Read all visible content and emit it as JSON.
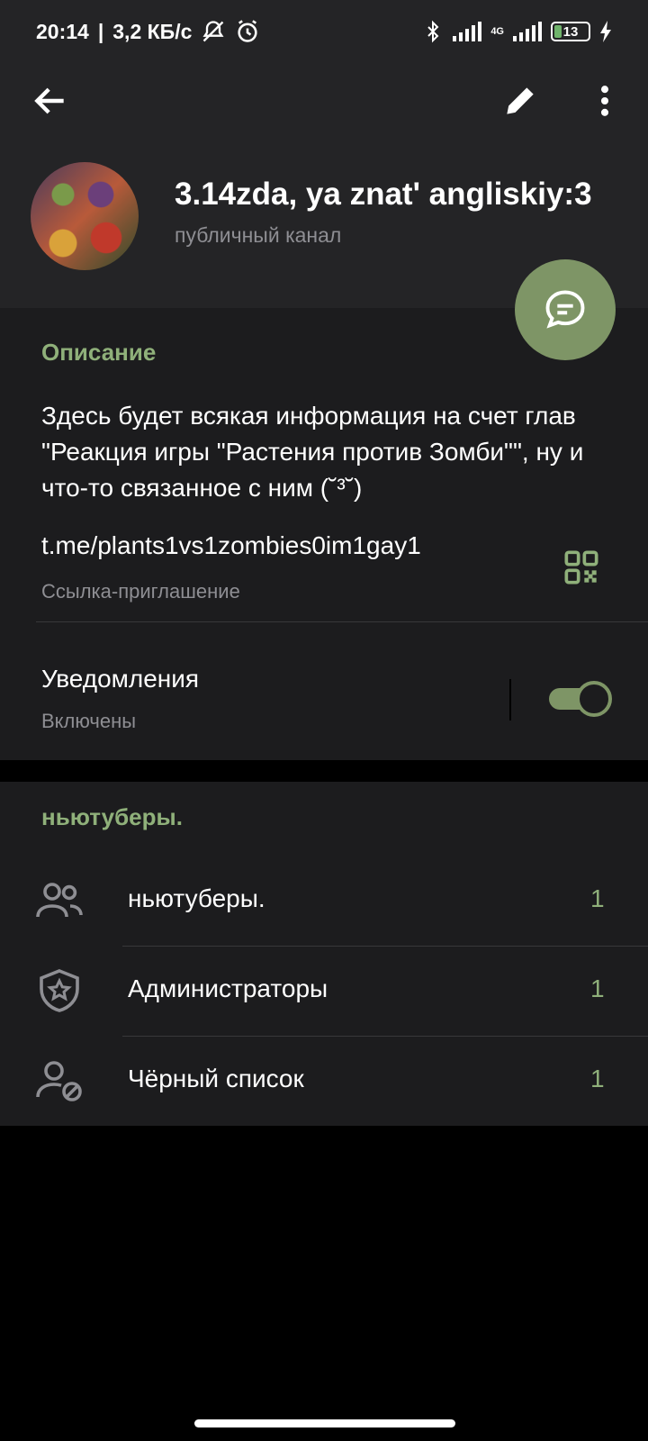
{
  "status": {
    "time": "20:14",
    "speed": "3,2 КБ/с",
    "network": "4G",
    "battery": "13"
  },
  "channel": {
    "title": "3.14zda, ya znat' angliskiy:3",
    "subtitle": "публичный канал"
  },
  "info": {
    "description_label": "Описание",
    "description": "Здесь будет всякая информация на счет глав \"Реакция игры \"Растения против Зомби\"\", ну и что-то связанное с ним (˘³˘)",
    "link": "t.me/plants1vs1zombies0im1gay1",
    "link_label": "Ссылка-приглашение",
    "notifications_label": "Уведомления",
    "notifications_state": "Включены"
  },
  "members": {
    "section_label": "ньютуберы.",
    "items": [
      {
        "icon": "people-icon",
        "label": "ньютуберы.",
        "count": "1"
      },
      {
        "icon": "shield-star-icon",
        "label": "Администраторы",
        "count": "1"
      },
      {
        "icon": "user-blocked-icon",
        "label": "Чёрный список",
        "count": "1"
      }
    ]
  },
  "colors": {
    "accent": "#8fb07a",
    "fab": "#7e9566",
    "panel": "#1c1c1e",
    "header": "#242426"
  }
}
